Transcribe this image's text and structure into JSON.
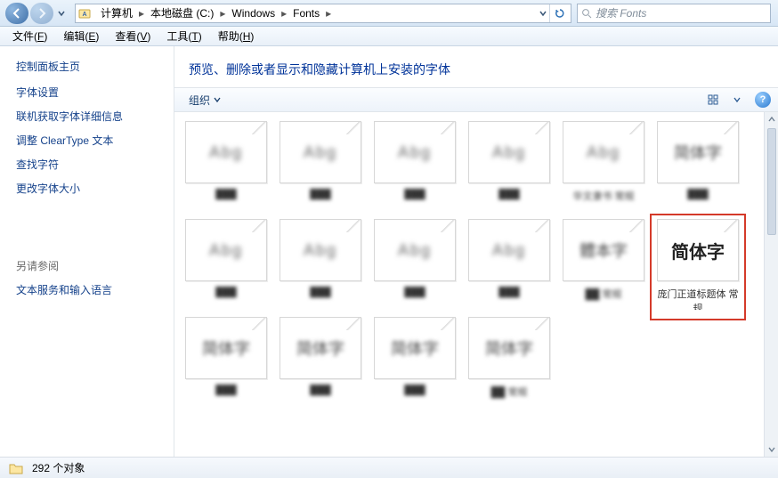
{
  "titlebar": {
    "breadcrumbs": [
      "计算机",
      "本地磁盘 (C:)",
      "Windows",
      "Fonts"
    ],
    "search_placeholder": "搜索 Fonts"
  },
  "menubar": {
    "items": [
      {
        "label": "文件",
        "hotkey": "F"
      },
      {
        "label": "编辑",
        "hotkey": "E"
      },
      {
        "label": "查看",
        "hotkey": "V"
      },
      {
        "label": "工具",
        "hotkey": "T"
      },
      {
        "label": "帮助",
        "hotkey": "H"
      }
    ]
  },
  "sidebar": {
    "heading": "控制面板主页",
    "links": [
      "字体设置",
      "联机获取字体详细信息",
      "调整 ClearType 文本",
      "查找字符",
      "更改字体大小"
    ],
    "see_also_heading": "另请参阅",
    "see_also_links": [
      "文本服务和输入语言"
    ]
  },
  "main": {
    "page_title": "预览、删除或者显示和隐藏计算机上安装的字体",
    "toolbar": {
      "organize_label": "组织"
    },
    "grid": {
      "rows": [
        [
          {
            "preview": "Abg",
            "label": "███",
            "clear": false
          },
          {
            "preview": "Abg",
            "label": "███",
            "clear": false
          },
          {
            "preview": "Abg",
            "label": "███",
            "clear": false
          },
          {
            "preview": "Abg",
            "label": "███",
            "clear": false
          },
          {
            "preview": "Abg",
            "label": "华文隶书 常规",
            "clear": false
          },
          {
            "preview": "简体字",
            "label": "███",
            "clear": false
          }
        ],
        [
          {
            "preview": "Abg",
            "label": "███",
            "clear": false
          },
          {
            "preview": "Abg",
            "label": "███",
            "clear": false
          },
          {
            "preview": "Abg",
            "label": "███",
            "clear": false
          },
          {
            "preview": "Abg",
            "label": "███",
            "clear": false
          },
          {
            "preview": "體本字",
            "label": "██ 常规",
            "clear": false
          },
          {
            "preview": "简体字",
            "label": "庞门正道标题体 常规",
            "clear": true
          }
        ],
        [
          {
            "preview": "简体字",
            "label": "███",
            "clear": false
          },
          {
            "preview": "简体字",
            "label": "███",
            "clear": false
          },
          {
            "preview": "简体字",
            "label": "███",
            "clear": false
          },
          {
            "preview": "简体字",
            "label": "██ 常规",
            "clear": false
          },
          {
            "preview": "",
            "label": "",
            "clear": false,
            "empty": true
          },
          {
            "preview": "",
            "label": "",
            "clear": false,
            "empty": true
          }
        ]
      ]
    },
    "highlight_tile": {
      "row": 1,
      "col": 5
    }
  },
  "statusbar": {
    "count_label": "292 个对象"
  }
}
